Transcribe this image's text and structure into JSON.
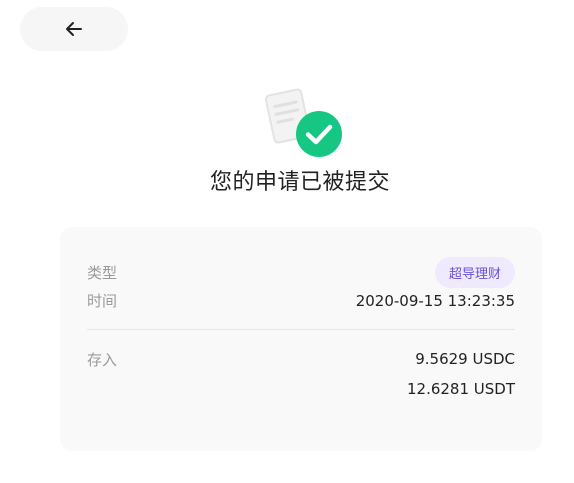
{
  "header": {
    "back_icon": "arrow-left-icon"
  },
  "hero": {
    "doc_icon": "document-icon",
    "check_icon": "check-circle-icon",
    "check_color": "#16c784",
    "title": "您的申请已被提交"
  },
  "details": {
    "type_label": "类型",
    "type_value": "超导理财",
    "time_label": "时间",
    "time_value": "2020-09-15 13:23:35",
    "deposit_label": "存入",
    "amounts": [
      "9.5629 USDC",
      "12.6281 USDT"
    ]
  },
  "colors": {
    "badge_bg": "#efeafd",
    "badge_text": "#6b4fd6"
  }
}
